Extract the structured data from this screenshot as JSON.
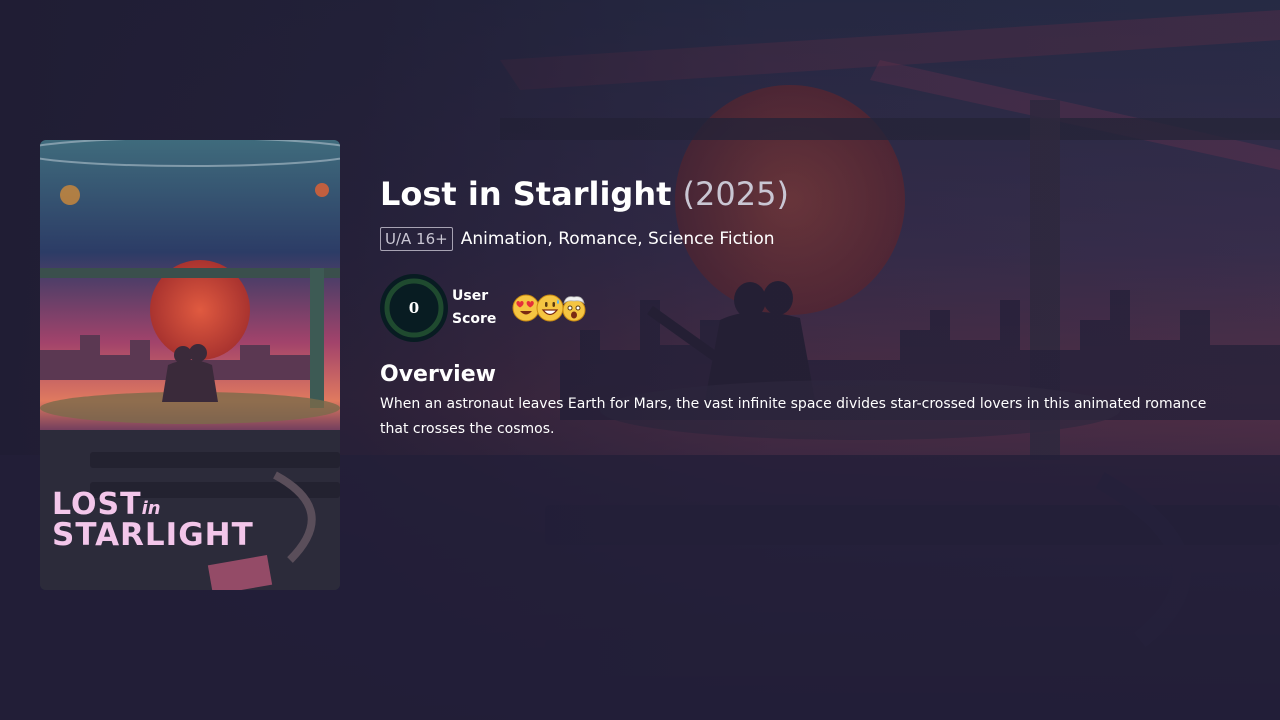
{
  "movie": {
    "title": "Lost in Starlight",
    "year": "(2025)",
    "certification": "U/A 16+",
    "genres": "Animation, Romance, Science Fiction",
    "user_score": {
      "value": "0",
      "percent": 0,
      "label": "User Score"
    },
    "reactions": [
      "heart-eyes-emoji",
      "grinning-sweat-emoji",
      "exploding-head-emoji"
    ],
    "overview_heading": "Overview",
    "overview": "When an astronaut leaves Earth for Mars, the vast infinite space divides star-crossed lovers in this animated romance that crosses the cosmos."
  },
  "poster": {
    "title_line1": "LOST",
    "title_in": "in",
    "title_line2": "STARLIGHT"
  },
  "colors": {
    "page_background": "#201d34",
    "score_track": "#1f4a2f",
    "score_ring_bg": "#081c22",
    "poster_title": "#f3c6ea"
  }
}
